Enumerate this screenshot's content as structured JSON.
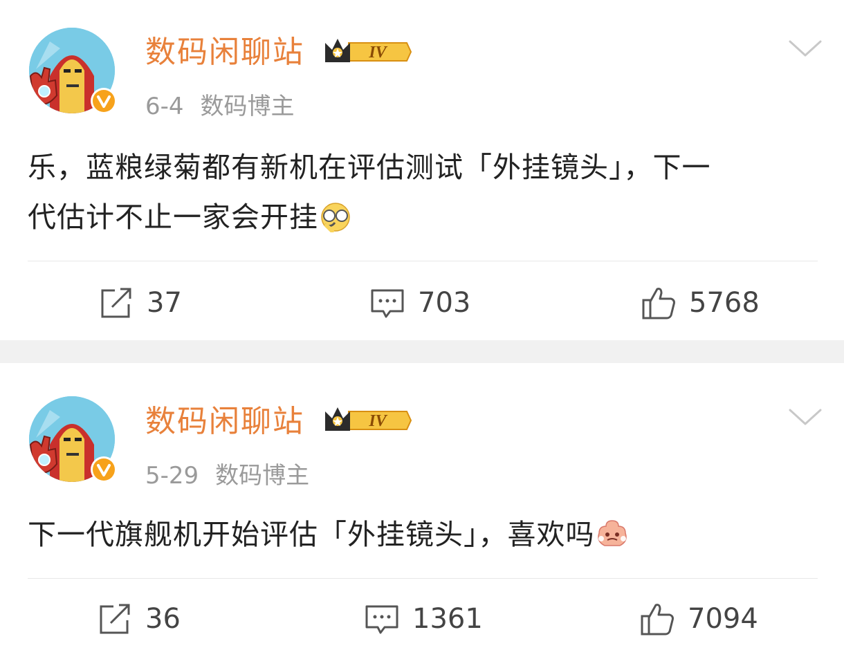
{
  "posts": [
    {
      "author": "数码闲聊站",
      "level": "IV",
      "date": "6-4",
      "role": "数码博主",
      "text_line1": "乐，蓝粮绿菊都有新机在评估测试「外挂镜头」，下一",
      "text_line2": "代估计不止一家会开挂",
      "emoji": "smirk-glasses-emoji",
      "reposts": "37",
      "comments": "703",
      "likes": "5768"
    },
    {
      "author": "数码闲聊站",
      "level": "IV",
      "date": "5-29",
      "role": "数码博主",
      "text_line1": "下一代旗舰机开始评估「外挂镜头」，喜欢吗",
      "emoji": "angry-steam-emoji",
      "reposts": "36",
      "comments": "1361",
      "likes": "7094"
    }
  ],
  "colors": {
    "author": "#e8813b",
    "meta": "#9a9a9a",
    "text": "#222222",
    "separator": "#f1f1f1"
  },
  "icons": {
    "repost": "repost-icon",
    "comment": "comment-icon",
    "like": "thumbs-up-icon",
    "menu": "chevron-down-icon",
    "verified": "verified-v-icon",
    "level": "crown-level-icon"
  }
}
